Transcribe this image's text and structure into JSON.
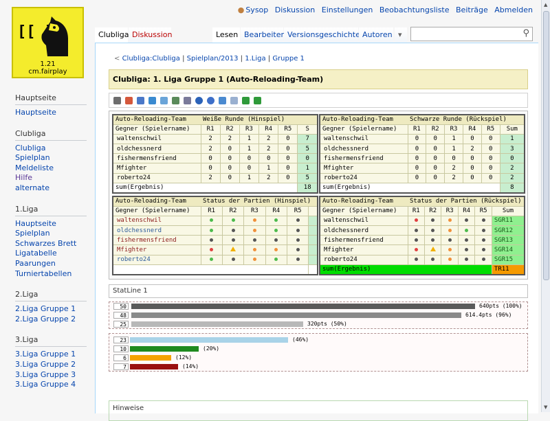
{
  "logo": {
    "glyph": "[[ ]]",
    "version": "1.21",
    "site": "cm.fairplay"
  },
  "sidebar": [
    {
      "heading": "Hauptseite",
      "items": [
        {
          "label": "Hauptseite"
        }
      ]
    },
    {
      "heading": "Clubliga",
      "items": [
        {
          "label": "Clubliga"
        },
        {
          "label": "Spielplan"
        },
        {
          "label": "Meldeliste"
        },
        {
          "label": "Hilfe"
        },
        {
          "label": "alternate"
        }
      ]
    },
    {
      "heading": "1.Liga",
      "items": [
        {
          "label": "Hauptseite"
        },
        {
          "label": "Spielplan"
        },
        {
          "label": "Schwarzes Brett"
        },
        {
          "label": "Ligatabelle"
        },
        {
          "label": "Paarungen"
        },
        {
          "label": "Turniertabellen"
        }
      ]
    },
    {
      "heading": "2.Liga",
      "items": [
        {
          "label": "2.Liga Gruppe 1"
        },
        {
          "label": "2.Liga Gruppe 2"
        }
      ]
    },
    {
      "heading": "3.Liga",
      "items": [
        {
          "label": "3.Liga Gruppe 1"
        },
        {
          "label": "3.Liga Gruppe 2"
        },
        {
          "label": "3.Liga Gruppe 3"
        },
        {
          "label": "3.Liga Gruppe 4"
        }
      ]
    }
  ],
  "personal": {
    "user": "Sysop",
    "links": [
      "Diskussion",
      "Einstellungen",
      "Beobachtungsliste",
      "Beiträge",
      "Abmelden"
    ]
  },
  "tabs": {
    "left": [
      "Clubliga",
      "Diskussion"
    ],
    "right": [
      "Lesen",
      "Bearbeiten",
      "Versionsgeschichte",
      "Autoren"
    ],
    "more": "▾"
  },
  "search": {
    "placeholder": ""
  },
  "breadcrumb": {
    "arrow": "<",
    "parts": [
      "Clubliga:Clubliga",
      "Spielplan/2013",
      "1.Liga",
      "Gruppe 1"
    ]
  },
  "title": "Clubliga: 1. Liga Gruppe 1 (Auto-Reloading-Team)",
  "icons": [
    "wrench-icon",
    "calendar-icon",
    "bar-chart-icon",
    "chart-icon",
    "table-icon",
    "export-icon",
    "print-icon",
    "info-icon",
    "help-icon",
    "stats-icon",
    "document-icon",
    "arrow-left-icon",
    "check-icon"
  ],
  "icon_colors": [
    "#6d6d6d",
    "#d4583c",
    "#4a78c8",
    "#3a8ad0",
    "#6aa4d8",
    "#5a8a5a",
    "#7a7a9a",
    "#2b62b8",
    "#3d6fc9",
    "#4b8ad0",
    "#9ab0d0",
    "#2f9a3a",
    "#2f9a3a"
  ],
  "tables": {
    "hin": {
      "team": "Auto-Reloading-Team",
      "round": "Weiße Runde (Hinspiel)",
      "cols": [
        "Gegner (Spielername)",
        "R1",
        "R2",
        "R3",
        "R4",
        "R5",
        "S"
      ],
      "rows": [
        {
          "name": "waltenschwil",
          "v": [
            "2",
            "2",
            "1",
            "2",
            "0"
          ],
          "s": "7"
        },
        {
          "name": "oldchessnerd",
          "v": [
            "2",
            "0",
            "1",
            "2",
            "0"
          ],
          "s": "5"
        },
        {
          "name": "fishermensfriend",
          "v": [
            "0",
            "0",
            "0",
            "0",
            "0"
          ],
          "s": "0"
        },
        {
          "name": "Mfighter",
          "v": [
            "0",
            "0",
            "0",
            "1",
            "0"
          ],
          "s": "1"
        },
        {
          "name": "roberto24",
          "v": [
            "2",
            "0",
            "1",
            "2",
            "0"
          ],
          "s": "5"
        }
      ],
      "sum_label": "sum(Ergebnis)",
      "sum": "18"
    },
    "rueck": {
      "team": "Auto-Reloading-Team",
      "round": "Schwarze Runde (Rückspiel)",
      "cols": [
        "Gegner (Spielername)",
        "R1",
        "R2",
        "R3",
        "R4",
        "R5",
        "Sum"
      ],
      "rows": [
        {
          "name": "waltenschwil",
          "v": [
            "0",
            "0",
            "1",
            "0",
            "0"
          ],
          "s": "1"
        },
        {
          "name": "oldchessnerd",
          "v": [
            "0",
            "0",
            "1",
            "2",
            "0"
          ],
          "s": "3"
        },
        {
          "name": "fishermensfriend",
          "v": [
            "0",
            "0",
            "0",
            "0",
            "0"
          ],
          "s": "0"
        },
        {
          "name": "Mfighter",
          "v": [
            "0",
            "0",
            "2",
            "0",
            "0"
          ],
          "s": "2"
        },
        {
          "name": "roberto24",
          "v": [
            "0",
            "0",
            "2",
            "0",
            "0"
          ],
          "s": "2"
        }
      ],
      "sum_label": "sum(Ergebnis)",
      "sum": "8"
    },
    "status_hin": {
      "team": "Auto-Reloading-Team",
      "round": "Status der Partien (Hinspiel)",
      "cols": [
        "Gegner (Spielername)",
        "R1",
        "R2",
        "R3",
        "R4",
        "R5",
        ""
      ],
      "rows": [
        {
          "name": "waltenschwil",
          "color": "#8b1a1a",
          "s": [
            "g",
            "g",
            "o",
            "g",
            "k"
          ]
        },
        {
          "name": "oldchessnerd",
          "color": "#2a5a9a",
          "s": [
            "g",
            "k",
            "o",
            "g",
            "k"
          ]
        },
        {
          "name": "fishermensfriend",
          "color": "#8b1a1a",
          "s": [
            "k",
            "k",
            "k",
            "k",
            "k"
          ]
        },
        {
          "name": "Mfighter",
          "color": "#8b1a1a",
          "s": [
            "r",
            "t",
            "o",
            "o",
            "k"
          ]
        },
        {
          "name": "roberto24",
          "color": "#2a5a9a",
          "s": [
            "g",
            "k",
            "o",
            "g",
            "k"
          ]
        }
      ]
    },
    "status_rueck": {
      "team": "Auto-Reloading-Team",
      "round": "Status der Partien (Rückspiel)",
      "cols": [
        "Gegner (Spielername)",
        "R1",
        "R2",
        "R3",
        "R4",
        "R5",
        "Sum"
      ],
      "rows": [
        {
          "name": "waltenschwil",
          "s": [
            "r",
            "k",
            "o",
            "k",
            "k"
          ],
          "sum": "SGR11"
        },
        {
          "name": "oldchessnerd",
          "s": [
            "k",
            "k",
            "o",
            "g",
            "k"
          ],
          "sum": "SGR12"
        },
        {
          "name": "fishermensfriend",
          "s": [
            "k",
            "k",
            "k",
            "k",
            "k"
          ],
          "sum": "SGR13"
        },
        {
          "name": "Mfighter",
          "s": [
            "r",
            "t",
            "o",
            "k",
            "k"
          ],
          "sum": "SGR14"
        },
        {
          "name": "roberto24",
          "s": [
            "k",
            "k",
            "o",
            "k",
            "k"
          ],
          "sum": "SGR15"
        }
      ],
      "sum_label": "sum(Ergebnis)",
      "sum": "TR11"
    }
  },
  "status_colors": {
    "g": "#4cbb4c",
    "o": "#f0903a",
    "r": "#e04040",
    "k": "#555555"
  },
  "statline": {
    "title": "StatLine 1"
  },
  "stats1": [
    {
      "num": "50",
      "pct": 100,
      "label": "640pts (100%)",
      "color": "#5a5a5a"
    },
    {
      "num": "48",
      "pct": 96,
      "label": "614.4pts (96%)",
      "color": "#8a8a8a"
    },
    {
      "num": "25",
      "pct": 50,
      "label": "320pts (50%)",
      "color": "#b8b8b8"
    }
  ],
  "stats2": [
    {
      "num": "23",
      "pct": 46,
      "label": "(46%)",
      "color": "#a9d3e8"
    },
    {
      "num": "10",
      "pct": 20,
      "label": "(20%)",
      "color": "#1f8a1f"
    },
    {
      "num": "6",
      "pct": 12,
      "label": "(12%)",
      "color": "#f5a300"
    },
    {
      "num": "7",
      "pct": 14,
      "label": "(14%)",
      "color": "#9a1010"
    }
  ],
  "hinweise": {
    "title": "Hinweise"
  }
}
